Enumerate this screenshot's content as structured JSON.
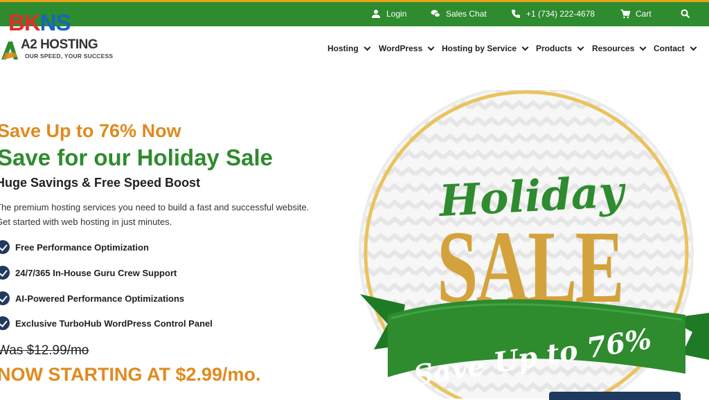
{
  "topbar": {
    "login": "Login",
    "sales_chat": "Sales Chat",
    "phone": "+1 (734) 222-4678",
    "cart": "Cart"
  },
  "watermark": {
    "text_red": "BK",
    "text_blue": "NS"
  },
  "logo": {
    "name": "A2 HOSTING",
    "tagline": "OUR SPEED, YOUR SUCCESS"
  },
  "nav": {
    "items": [
      {
        "label": "Hosting"
      },
      {
        "label": "WordPress"
      },
      {
        "label": "Hosting by Service"
      },
      {
        "label": "Products"
      },
      {
        "label": "Resources"
      },
      {
        "label": "Contact"
      }
    ]
  },
  "hero": {
    "headline_orange": "Save Up to 76% Now",
    "headline_green": "Save for our Holiday Sale",
    "subheadline": "Huge Savings & Free Speed Boost",
    "body_line1": "The premium hosting services you need to build a fast and successful website.",
    "body_line2": "Get started with web hosting in just minutes.",
    "features": [
      "Free Performance Optimization",
      "24/7/365 In-House Guru Crew Support",
      "AI-Powered Performance Optimizations",
      "Exclusive TurboHub WordPress Control Panel"
    ],
    "was_price": "Was $12.99/mo",
    "now_price": "NOW STARTING AT $2.99/mo."
  },
  "badge": {
    "script_word": "Holiday",
    "big_word": "SALE",
    "ribbon_text": "Save Up to 76%"
  },
  "colors": {
    "brand_green": "#2e8b2e",
    "accent_orange": "#e08a1e",
    "gold": "#d4a23c",
    "navy": "#1f3a5f"
  }
}
